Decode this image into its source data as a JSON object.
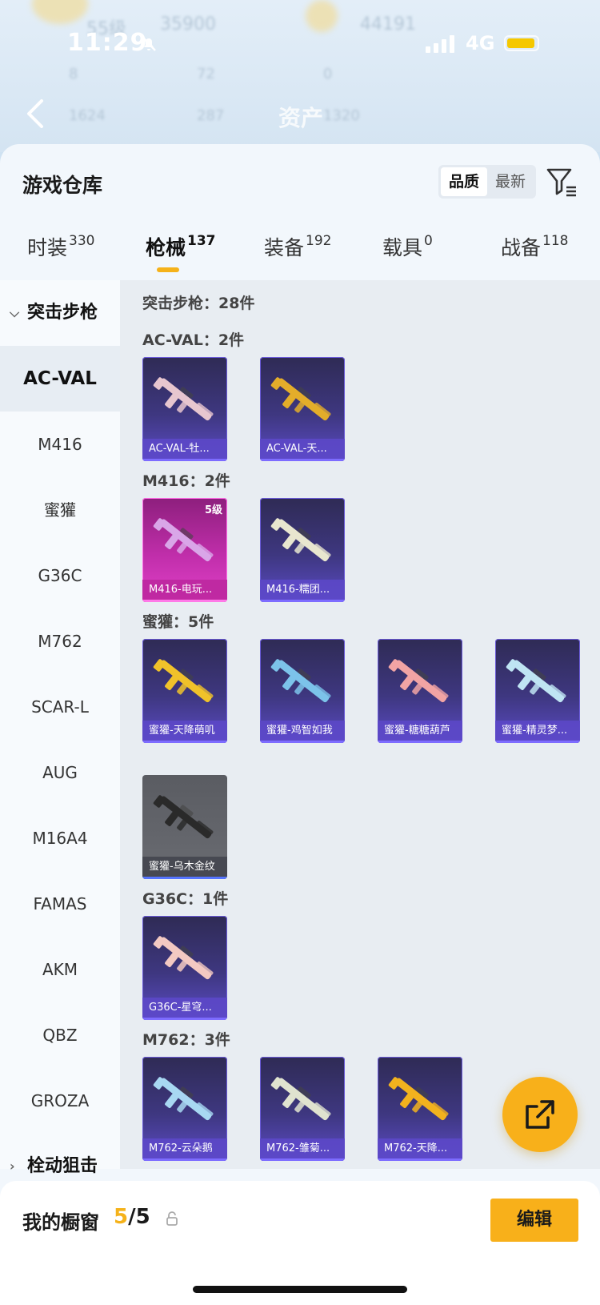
{
  "status_bar": {
    "time": "11:29",
    "network": "4G"
  },
  "background": {
    "title": "资产",
    "ghost_texts": [
      "55级",
      "35900",
      "44191",
      "8",
      "72",
      "0",
      "1624",
      "287",
      "1320"
    ]
  },
  "warehouse": {
    "title": "游戏仓库",
    "sort_options": [
      {
        "label": "品质",
        "active": true
      },
      {
        "label": "最新",
        "active": false
      }
    ]
  },
  "tabs": [
    {
      "label": "时装",
      "count": "330"
    },
    {
      "label": "枪械",
      "count": "137",
      "active": true
    },
    {
      "label": "装备",
      "count": "192"
    },
    {
      "label": "载具",
      "count": "0"
    },
    {
      "label": "战备",
      "count": "118"
    }
  ],
  "categories": {
    "group_open": "突击步枪",
    "items": [
      "AC-VAL",
      "M416",
      "蜜獾",
      "G36C",
      "M762",
      "SCAR-L",
      "AUG",
      "M16A4",
      "FAMAS",
      "AKM",
      "QBZ",
      "GROZA"
    ],
    "selected": "AC-VAL",
    "group_closed": "栓动狙击"
  },
  "content": {
    "summary": "突击步枪：28件",
    "sections": [
      {
        "title": "AC-VAL：2件",
        "cards": [
          {
            "name": "AC-VAL-牡...",
            "style": "purple",
            "gun_color": "#e7c6cf"
          },
          {
            "name": "AC-VAL-天...",
            "style": "purple",
            "gun_color": "#e3ad2a"
          }
        ]
      },
      {
        "title": "M416：2件",
        "cards": [
          {
            "name": "M416-电玩...",
            "style": "pink",
            "level": "5级",
            "gun_color": "#d9a6e8"
          },
          {
            "name": "M416-糯团...",
            "style": "purple",
            "gun_color": "#e8e6cf"
          }
        ]
      },
      {
        "title": "蜜獾：5件",
        "cards": [
          {
            "name": "蜜獾-天降萌叽",
            "style": "purple",
            "gun_color": "#f0c22a"
          },
          {
            "name": "蜜獾-鸡智如我",
            "style": "purple",
            "gun_color": "#7cc3ea"
          },
          {
            "name": "蜜獾-糖糖葫芦",
            "style": "purple",
            "gun_color": "#f1a4a4"
          },
          {
            "name": "蜜獾-精灵梦...",
            "style": "purple",
            "gun_color": "#bfe4f3"
          },
          {
            "name": "蜜獾-乌木金纹",
            "style": "gray",
            "gun_color": "#2a2a2a"
          }
        ]
      },
      {
        "title": "G36C：1件",
        "cards": [
          {
            "name": "G36C-星穹...",
            "style": "purple",
            "gun_color": "#f3c9c2"
          }
        ]
      },
      {
        "title": "M762：3件",
        "cards": [
          {
            "name": "M762-云朵鹅",
            "style": "purple",
            "gun_color": "#a8d8f2"
          },
          {
            "name": "M762-雏菊...",
            "style": "purple",
            "gun_color": "#e0e3cf"
          },
          {
            "name": "M762-天降...",
            "style": "purple",
            "gun_color": "#f2b21e"
          }
        ]
      }
    ]
  },
  "showcase": {
    "title": "我的橱窗",
    "used": "5",
    "total": "/5",
    "edit_label": "编辑"
  },
  "colors": {
    "accent": "#f8b01a",
    "card_purple": "#3e3780",
    "card_pink": "#c02eaa"
  }
}
